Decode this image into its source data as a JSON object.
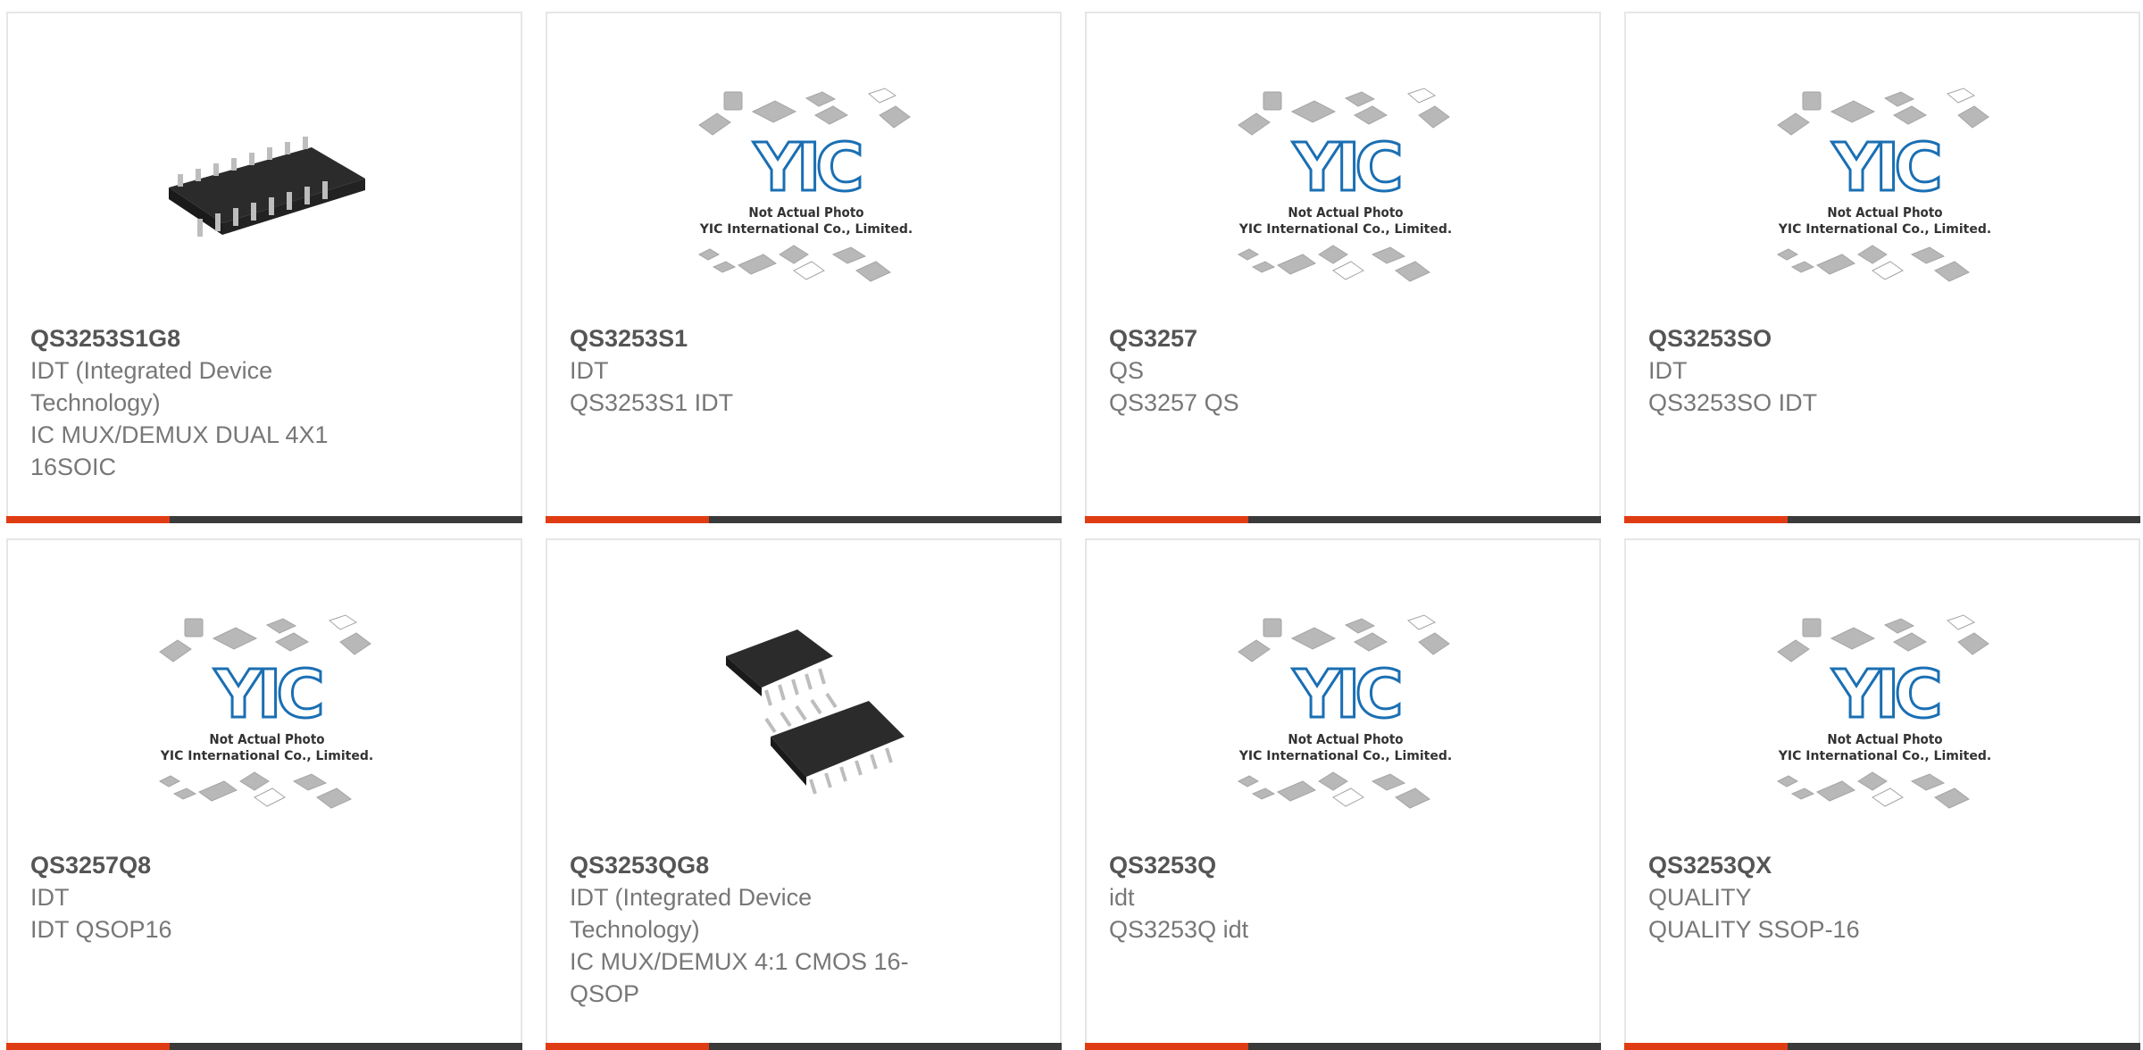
{
  "colors": {
    "accent": "#e03c14",
    "bar": "#3a3a3a",
    "border": "#e6e6e6",
    "text": "#777777",
    "title": "#555555",
    "logo": "#1a6fb3"
  },
  "placeholder": {
    "logo_text": "YIC",
    "caption_line1": "Not Actual Photo",
    "caption_line2": "YIC International Co., Limited."
  },
  "products": [
    {
      "part": "QS3253S1G8",
      "maker": "IDT (Integrated Device Technology)",
      "desc": "IC MUX/DEMUX DUAL 4X1 16SOIC",
      "image": "soic-photo-icon"
    },
    {
      "part": "QS3253S1",
      "maker": "IDT",
      "desc": "QS3253S1 IDT",
      "image": "yic-placeholder"
    },
    {
      "part": "QS3257",
      "maker": "QS",
      "desc": "QS3257 QS",
      "image": "yic-placeholder"
    },
    {
      "part": "QS3253SO",
      "maker": "IDT",
      "desc": "QS3253SO IDT",
      "image": "yic-placeholder"
    },
    {
      "part": "QS3257Q8",
      "maker": "IDT",
      "desc": "IDT QSOP16",
      "image": "yic-placeholder"
    },
    {
      "part": "QS3253QG8",
      "maker": "IDT (Integrated Device Technology)",
      "desc": "IC MUX/DEMUX 4:1 CMOS 16-QSOP",
      "image": "qsop-photo-icon"
    },
    {
      "part": "QS3253Q",
      "maker": "idt",
      "desc": "QS3253Q idt",
      "image": "yic-placeholder"
    },
    {
      "part": "QS3253QX",
      "maker": "QUALITY",
      "desc": "QUALITY SSOP-16",
      "image": "yic-placeholder"
    }
  ]
}
